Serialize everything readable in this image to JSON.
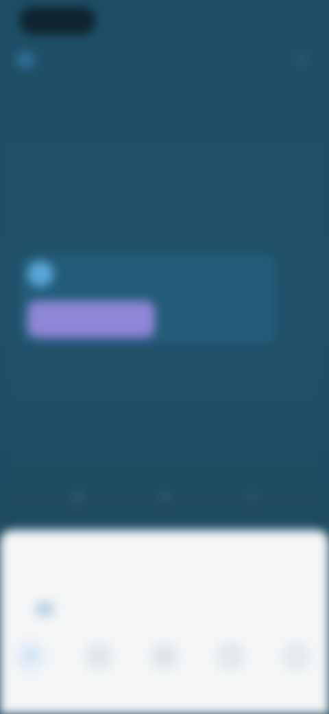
{
  "status_bar": {
    "time": "",
    "icons": ""
  },
  "header": {
    "title": "",
    "action_icon": "more-icon"
  },
  "tabs": [
    {
      "label": ""
    },
    {
      "label": ""
    },
    {
      "label": ""
    },
    {
      "label": ""
    },
    {
      "label": ""
    }
  ],
  "main": {
    "caption": "",
    "card": {
      "name": "",
      "button_label": ""
    },
    "footer_link": ""
  },
  "app_nav": [
    {
      "icon": "home-icon"
    },
    {
      "icon": "search-icon"
    },
    {
      "icon": "profile-icon"
    }
  ],
  "share_sheet": {
    "title": "",
    "row": {
      "label": ""
    },
    "targets": [
      {
        "icon": "share-icon",
        "label": ""
      },
      {
        "icon": "message-icon",
        "label": ""
      },
      {
        "icon": "mail-icon",
        "label": ""
      },
      {
        "icon": "copy-icon",
        "label": ""
      },
      {
        "icon": "more-icon",
        "label": ""
      }
    ]
  },
  "colors": {
    "app_background": "#1f4d63",
    "card_background": "#235c7a",
    "card_button": "#8e86d6",
    "avatar": "#5aa6d9",
    "sheet_background": "#f4f6f7",
    "share_primary": "#7fb6e6"
  }
}
